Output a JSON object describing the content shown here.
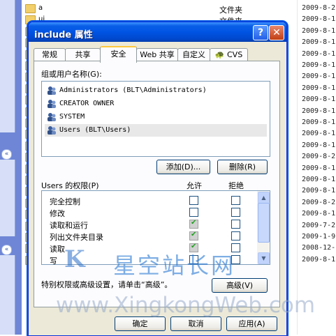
{
  "explorer": {
    "rows": [
      {
        "name": "a",
        "type": "文件夹",
        "date": "2009-8-2"
      },
      {
        "name": "ui",
        "type": "文件夹",
        "date": "2009-8-1"
      },
      {
        "name": "",
        "type": "",
        "date": "2009-8-1"
      },
      {
        "name": "",
        "type": "",
        "date": "2009-8-1"
      },
      {
        "name": "",
        "type": "",
        "date": "2009-8-1"
      },
      {
        "name": "",
        "type": "",
        "date": "2009-8-1"
      },
      {
        "name": "",
        "type": "",
        "date": "2009-8-1"
      },
      {
        "name": "",
        "type": "",
        "date": "2009-8-1"
      },
      {
        "name": "",
        "type": "",
        "date": "2009-8-1"
      },
      {
        "name": "",
        "type": "",
        "date": "2009-8-1"
      },
      {
        "name": "",
        "type": "",
        "date": "2009-8-1"
      },
      {
        "name": "",
        "type": "",
        "date": "2009-8-1"
      },
      {
        "name": "",
        "type": "",
        "date": "2009-8-1"
      },
      {
        "name": "",
        "type": "",
        "date": "2009-8-2"
      },
      {
        "name": "",
        "type": "",
        "date": "2009-8-1"
      },
      {
        "name": "",
        "type": "",
        "date": "2009-8-1"
      },
      {
        "name": "",
        "type": "",
        "date": "2009-8-1"
      },
      {
        "name": "",
        "type": "",
        "date": "2009-8-2"
      },
      {
        "name": "",
        "type": "",
        "date": "2009-8-1"
      },
      {
        "name": "",
        "type": "",
        "date": "2009-7-2"
      },
      {
        "name": "",
        "type": "",
        "date": "2009-1-9"
      },
      {
        "name": "",
        "type": "",
        "date": "2008-12-"
      },
      {
        "name": "",
        "type": "",
        "date": "2009-8-1"
      }
    ]
  },
  "dialog": {
    "title": "include 属性",
    "help_glyph": "?",
    "close_glyph": "✕",
    "tabs": [
      "常规",
      "共享",
      "安全",
      "Web 共享",
      "自定义",
      "CVS"
    ],
    "active_tab": "安全",
    "group_label": "组或用户名称(G):",
    "users": [
      "Administrators (BLT\\Administrators)",
      "CREATOR OWNER",
      "SYSTEM",
      "Users (BLT\\Users)"
    ],
    "selected_user": "Users (BLT\\Users)",
    "add_button": "添加(D)...",
    "remove_button": "删除(R)",
    "perm_label": "Users 的权限(P)",
    "allow_label": "允许",
    "deny_label": "拒绝",
    "permissions": [
      {
        "name": "完全控制",
        "allow": false,
        "deny": false
      },
      {
        "name": "修改",
        "allow": false,
        "deny": false
      },
      {
        "name": "读取和运行",
        "allow": true,
        "deny": false
      },
      {
        "name": "列出文件夹目录",
        "allow": true,
        "deny": false
      },
      {
        "name": "读取",
        "allow": true,
        "deny": false
      },
      {
        "name": "写",
        "allow": false,
        "deny": false
      }
    ],
    "advanced_note": "特别权限或高级设置，请单击“高级”。",
    "advanced_button": "高级(V)",
    "ok_button": "确定",
    "cancel_button": "取消",
    "apply_button": "应用(A)"
  },
  "watermark": {
    "logo": "K",
    "name": "星空站长网",
    "url": "www.XingkongWeb.com"
  },
  "colors": {
    "title_bar": "#0054e3",
    "dialog_face": "#ece9d8",
    "taskpane": "#6f86d6",
    "tab_highlight": "#ffc83c"
  }
}
